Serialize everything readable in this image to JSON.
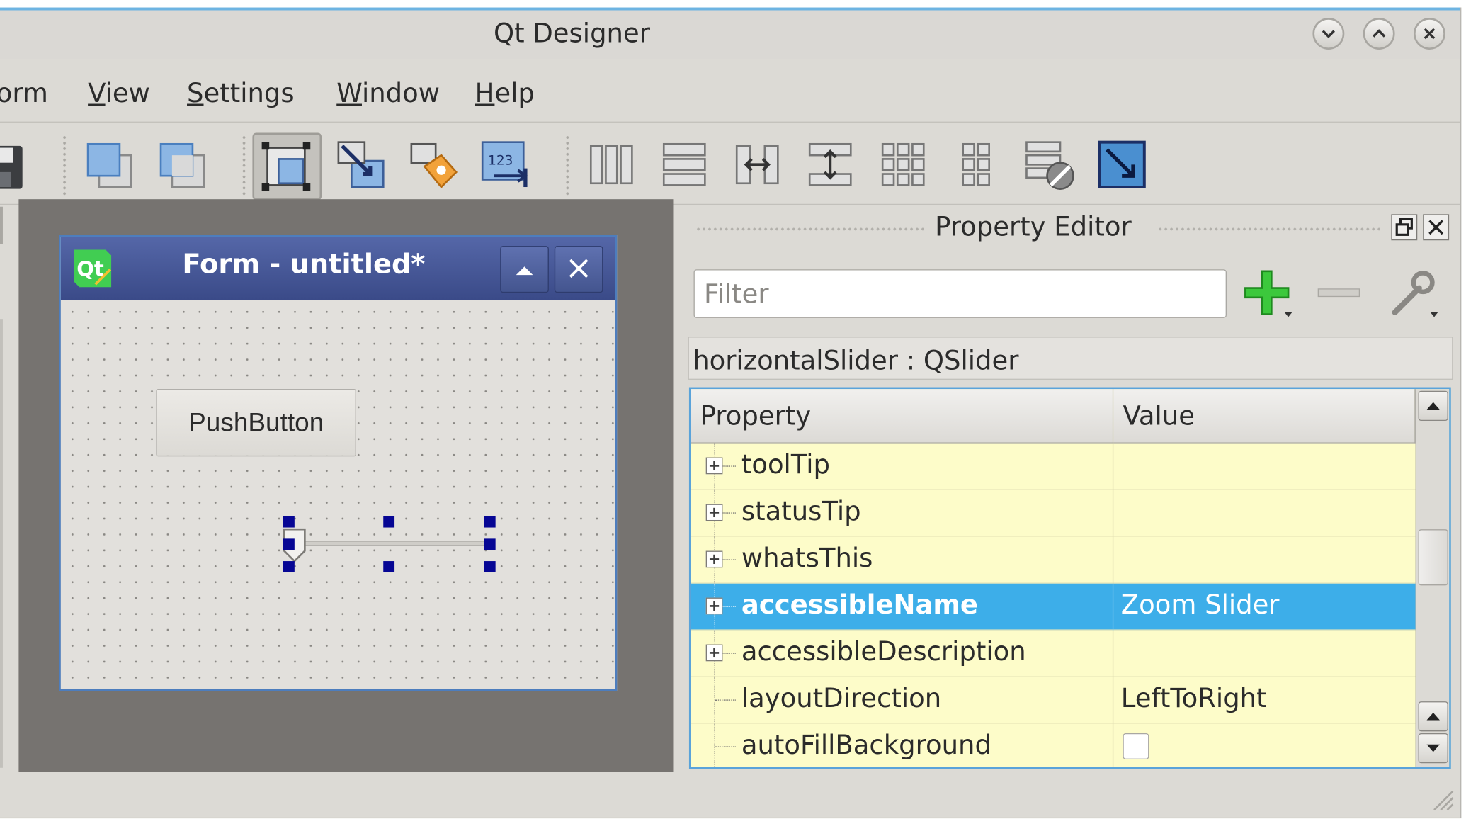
{
  "window": {
    "title": "Qt Designer"
  },
  "menu": [
    {
      "label": "orm",
      "mnemonic": ""
    },
    {
      "label": "View",
      "mnemonic": "V"
    },
    {
      "label": "Settings",
      "mnemonic": "S"
    },
    {
      "label": "Window",
      "mnemonic": "W"
    },
    {
      "label": "Help",
      "mnemonic": "H"
    }
  ],
  "toolbar": {
    "icons": [
      "save-icon",
      "bring-to-front-icon",
      "send-to-back-icon",
      "edit-widgets-icon",
      "edit-signals-slots-icon",
      "edit-buddies-icon",
      "edit-tab-order-icon",
      "layout-horizontal-icon",
      "layout-vertical-icon",
      "layout-horizontal-splitter-icon",
      "layout-vertical-splitter-icon",
      "layout-grid-icon",
      "layout-form-icon",
      "break-layout-icon",
      "adjust-size-icon"
    ]
  },
  "form": {
    "title": "Form - untitled*",
    "logo_text": "Qt",
    "push_button_label": "PushButton"
  },
  "property_editor": {
    "title": "Property Editor",
    "filter_placeholder": "Filter",
    "object_name": "horizontalSlider : QSlider",
    "columns": [
      "Property",
      "Value"
    ],
    "rows": [
      {
        "name": "toolTip",
        "value": "",
        "expandable": true,
        "selected": false
      },
      {
        "name": "statusTip",
        "value": "",
        "expandable": true,
        "selected": false
      },
      {
        "name": "whatsThis",
        "value": "",
        "expandable": true,
        "selected": false
      },
      {
        "name": "accessibleName",
        "value": "Zoom Slider",
        "expandable": true,
        "selected": true
      },
      {
        "name": "accessibleDescription",
        "value": "",
        "expandable": true,
        "selected": false
      },
      {
        "name": "layoutDirection",
        "value": "LeftToRight",
        "expandable": false,
        "selected": false
      },
      {
        "name": "autoFillBackground",
        "value": "",
        "expandable": false,
        "selected": false,
        "checkbox": true,
        "checked": false
      }
    ]
  },
  "colors": {
    "selection": "#3daee9",
    "accent_border": "#5aa3da",
    "form_title": "#3a4a88",
    "row_bg": "#fdfcc9",
    "window_bg": "#dcdad5",
    "add_icon": "#3cc83c"
  }
}
